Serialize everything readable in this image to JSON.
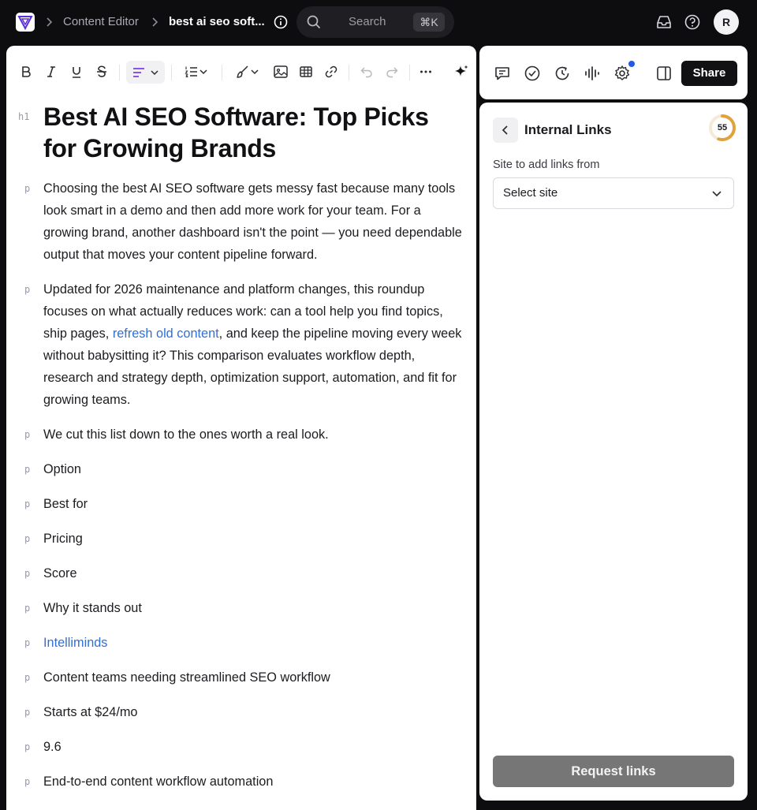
{
  "topbar": {
    "app_logo": "triangle-logo-icon",
    "breadcrumb_parent": "Content Editor",
    "breadcrumb_current": "best ai seo soft...",
    "search_placeholder": "Search",
    "search_shortcut": "⌘K",
    "avatar_initial": "R"
  },
  "toolbar": {
    "buttons": [
      "bold",
      "italic",
      "underline",
      "strikethrough",
      "align",
      "list",
      "highlight",
      "image",
      "table",
      "link",
      "undo",
      "redo",
      "more",
      "ai-sparkle"
    ]
  },
  "document": {
    "h1_tag": "h1",
    "p_tag": "p",
    "title": "Best AI SEO Software: Top Picks for Growing Brands",
    "intro": "Choosing the best AI SEO software gets messy fast because many tools look smart in a demo and then add more work for your team. For a growing brand, another dashboard isn't the point — you need dependable output that moves your content pipeline forward.",
    "para2_before": "Updated for 2026 maintenance and platform changes, this roundup focuses on what actually reduces work: can a tool help you find topics, ship pages, ",
    "para2_link": "refresh old content",
    "para2_after": ", and keep the pipeline moving every week without babysitting it? This comparison evaluates workflow depth, research and strategy depth, optimization support, automation, and fit for growing teams.",
    "para3": "We cut this list down to the ones worth a real look.",
    "rows": [
      {
        "text": "Option",
        "link": false
      },
      {
        "text": "Best for",
        "link": false
      },
      {
        "text": "Pricing",
        "link": false
      },
      {
        "text": "Score",
        "link": false
      },
      {
        "text": "Why it stands out",
        "link": false
      },
      {
        "text": "Intelliminds",
        "link": true
      },
      {
        "text": "Content teams needing streamlined SEO workflow",
        "link": false
      },
      {
        "text": "Starts at $24/mo",
        "link": false
      },
      {
        "text": "9.6",
        "link": false
      },
      {
        "text": "End-to-end content workflow automation",
        "link": false
      }
    ]
  },
  "right_toolbar": {
    "share_label": "Share"
  },
  "internal_links": {
    "title": "Internal Links",
    "score": "55",
    "score_fraction": 0.55,
    "field_label": "Site to add links from",
    "select_value": "Select site",
    "request_label": "Request links"
  },
  "colors": {
    "accent_link": "#2f6fd6",
    "score_ring": "#e1a23c",
    "notification_dot": "#2358e8",
    "align_active": "#7b3fe4"
  }
}
